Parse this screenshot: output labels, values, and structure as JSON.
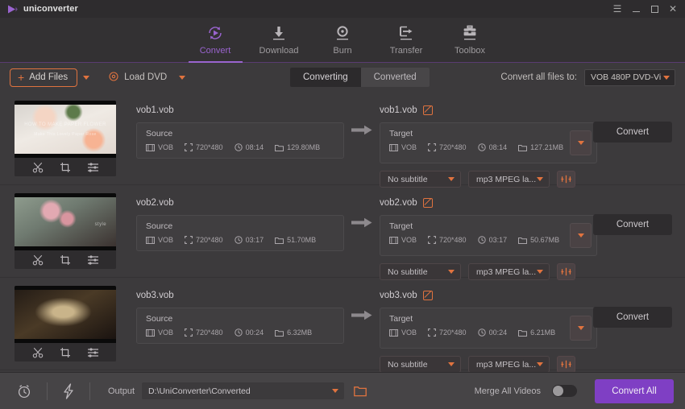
{
  "window": {
    "brand": "uniconverter",
    "controls": {
      "menu": "☰",
      "minimize": "＿",
      "maximize": "□",
      "close": "✕"
    }
  },
  "nav": {
    "items": [
      {
        "label": "Convert",
        "icon": "convert-icon",
        "active": true
      },
      {
        "label": "Download",
        "icon": "download-icon",
        "active": false
      },
      {
        "label": "Burn",
        "icon": "burn-icon",
        "active": false
      },
      {
        "label": "Transfer",
        "icon": "transfer-icon",
        "active": false
      },
      {
        "label": "Toolbox",
        "icon": "toolbox-icon",
        "active": false
      }
    ]
  },
  "toolbar": {
    "add_files": "Add Files",
    "load_dvd": "Load DVD",
    "tabs": [
      {
        "label": "Converting",
        "active": true
      },
      {
        "label": "Converted",
        "active": false
      }
    ],
    "convert_all_label": "Convert all files to:",
    "format_value": "VOB 480P DVD-Vi"
  },
  "files": [
    {
      "name": "vob1.vob",
      "source": {
        "title": "Source",
        "format": "VOB",
        "resolution": "720*480",
        "duration": "08:14",
        "size": "129.80MB"
      },
      "target": {
        "name": "vob1.vob",
        "title": "Target",
        "format": "VOB",
        "resolution": "720*480",
        "duration": "08:14",
        "size": "127.21MB"
      },
      "subtitle": "No subtitle",
      "audio": "mp3 MPEG la...",
      "convert_label": "Convert",
      "tools": [
        "trim-icon",
        "crop-icon",
        "effects-icon"
      ]
    },
    {
      "name": "vob2.vob",
      "source": {
        "title": "Source",
        "format": "VOB",
        "resolution": "720*480",
        "duration": "03:17",
        "size": "51.70MB"
      },
      "target": {
        "name": "vob2.vob",
        "title": "Target",
        "format": "VOB",
        "resolution": "720*480",
        "duration": "03:17",
        "size": "50.67MB"
      },
      "subtitle": "No subtitle",
      "audio": "mp3 MPEG la...",
      "convert_label": "Convert",
      "tools": [
        "trim-icon",
        "crop-icon",
        "effects-icon"
      ]
    },
    {
      "name": "vob3.vob",
      "source": {
        "title": "Source",
        "format": "VOB",
        "resolution": "720*480",
        "duration": "00:24",
        "size": "6.32MB"
      },
      "target": {
        "name": "vob3.vob",
        "title": "Target",
        "format": "VOB",
        "resolution": "720*480",
        "duration": "00:24",
        "size": "6.21MB"
      },
      "subtitle": "No subtitle",
      "audio": "mp3 MPEG la...",
      "convert_label": "Convert",
      "tools": [
        "trim-icon",
        "crop-icon",
        "effects-icon"
      ]
    }
  ],
  "thumbnails": {
    "one_caption": "HOW TO MAKE PAPER FLOWER",
    "one_subcaption": "Make This Lovely Paper Rose",
    "two_caption": "style"
  },
  "bottom": {
    "output_label": "Output",
    "output_path": "D:\\UniConverter\\Converted",
    "merge_label": "Merge All Videos",
    "merge_on": false,
    "convert_all_label": "Convert All"
  },
  "colors": {
    "accent_purple": "#7f3fc4",
    "accent_orange": "#e0733f",
    "nav_active": "#9a64cf",
    "window_bg": "#3c3a3c",
    "panel_bg": "#403e40",
    "titlebar_bg": "#2e2c2e"
  }
}
